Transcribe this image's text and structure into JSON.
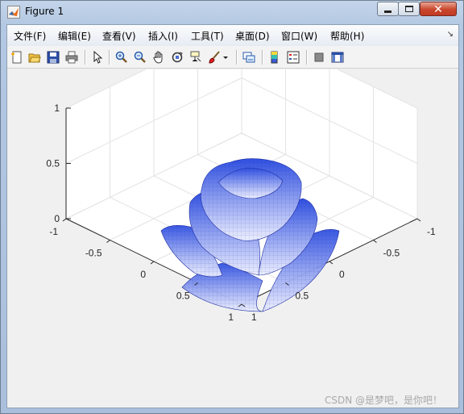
{
  "window": {
    "title": "Figure 1"
  },
  "menu": [
    {
      "label": "文件(F)"
    },
    {
      "label": "编辑(E)"
    },
    {
      "label": "查看(V)"
    },
    {
      "label": "插入(I)"
    },
    {
      "label": "工具(T)"
    },
    {
      "label": "桌面(D)"
    },
    {
      "label": "窗口(W)"
    },
    {
      "label": "帮助(H)"
    }
  ],
  "toolbar": [
    "new-figure-icon",
    "open-icon",
    "save-icon",
    "print-icon",
    "edit-plot-icon",
    "zoom-in-icon",
    "zoom-out-icon",
    "pan-icon",
    "rotate-3d-icon",
    "data-cursor-icon",
    "brush-icon",
    "link-plot-icon",
    "colorbar-icon",
    "legend-icon",
    "hide-plot-tools-icon",
    "show-plot-tools-icon"
  ],
  "axes": {
    "z_ticks": [
      "1",
      "0.5",
      "0"
    ],
    "x_ticks": [
      "-1",
      "-0.5",
      "0",
      "0.5",
      "1"
    ],
    "y_ticks": [
      "-1",
      "-0.5",
      "0",
      "0.5",
      "1"
    ],
    "zlim": [
      0,
      1
    ],
    "xlim": [
      -1,
      1
    ],
    "ylim": [
      -1,
      1
    ],
    "grid": "on"
  },
  "surface": {
    "color_top": "#2f4fe0",
    "color_bottom": "#eef0ff",
    "edge_color": "#1a2aa0"
  },
  "watermark": "CSDN @是梦吧，是你吧！"
}
